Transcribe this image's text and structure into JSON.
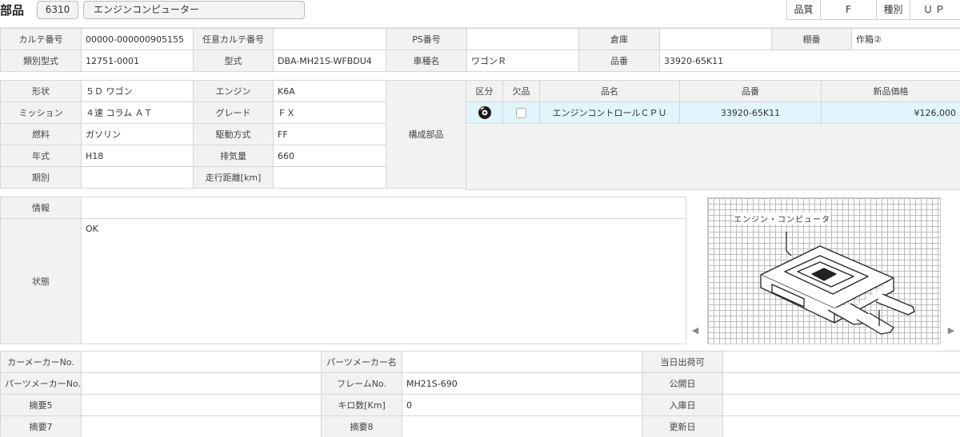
{
  "header": {
    "title": "部品",
    "code": "6310",
    "part_name": "エンジンコンピューター",
    "quality_label": "品質",
    "quality_value": "F",
    "type_label": "種別",
    "type_value": "ＵＰ"
  },
  "info_row1": {
    "karte_label": "カルテ番号",
    "karte_value": "00000-000000905155",
    "optional_karte_label": "任意カルテ番号",
    "optional_karte_value": "",
    "ps_label": "PS番号",
    "ps_value": "",
    "warehouse_label": "倉庫",
    "warehouse_value": "",
    "shelf_label": "棚番",
    "shelf_value": "作箱②"
  },
  "info_row2": {
    "class_model_label": "類別型式",
    "class_model_value": "12751-0001",
    "model_label": "型式",
    "model_value": "DBA-MH21S-WFBDU4",
    "vehicle_label": "車種名",
    "vehicle_value": "ワゴンＲ",
    "part_no_label": "品番",
    "part_no_value": "33920-65K11"
  },
  "specs": {
    "shape_label": "形状",
    "shape_value": "５Ｄ ワゴン",
    "engine_label": "エンジン",
    "engine_value": "K6A",
    "mission_label": "ミッション",
    "mission_value": "４速 コラム ＡＴ",
    "grade_label": "グレード",
    "grade_value": "ＦＸ",
    "fuel_label": "燃料",
    "fuel_value": "ガソリン",
    "drive_label": "駆動方式",
    "drive_value": "FF",
    "year_label": "年式",
    "year_value": "H18",
    "displacement_label": "排気量",
    "displacement_value": "660",
    "period_label": "期別",
    "period_value": "",
    "mileage_label": "走行距離[km]",
    "mileage_value": "",
    "components_label": "構成部品"
  },
  "parts_table": {
    "headers": [
      "区分",
      "欠品",
      "品名",
      "品番",
      "新品価格"
    ],
    "row": {
      "name": "エンジンコントロールＣＰＵ",
      "part_no": "33920-65K11",
      "price": "¥126,000"
    }
  },
  "notes": {
    "info_label": "情報",
    "info_value": "",
    "status_label": "状態",
    "status_value": "OK"
  },
  "diagram": {
    "caption": "エンジン・コンピュータ"
  },
  "footer": {
    "carmaker_no_label": "カーメーカーNo.",
    "carmaker_no_value": "",
    "partsmaker_name_label": "パーツメーカー名",
    "partsmaker_name_value": "",
    "same_day_label": "当日出荷可",
    "same_day_value": "",
    "partsmaker_no_label": "パーツメーカーNo.",
    "partsmaker_no_value": "",
    "frame_no_label": "フレームNo.",
    "frame_no_value": "MH21S-690",
    "publish_date_label": "公開日",
    "publish_date_value": "",
    "memo5_label": "摘要5",
    "memo5_value": "",
    "km_label": "キロ数[Km]",
    "km_value": "0",
    "arrival_date_label": "入庫日",
    "arrival_date_value": "",
    "memo7_label": "摘要7",
    "memo7_value": "",
    "memo8_label": "摘要8",
    "memo8_value": "",
    "update_date_label": "更新日",
    "update_date_value": ""
  },
  "icons": {
    "category_icon": "disc-icon",
    "scroll_left": "chevron-left-icon",
    "scroll_right": "chevron-right-icon"
  }
}
